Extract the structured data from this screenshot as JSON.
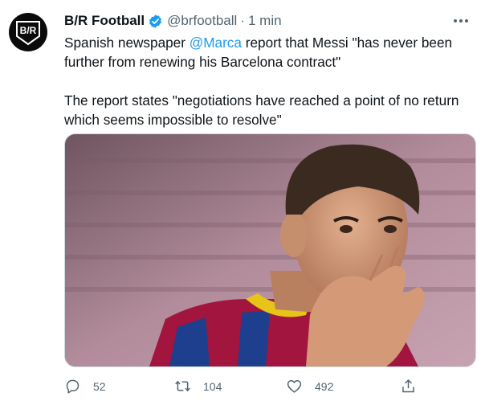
{
  "account": {
    "display_name": "B/R Football",
    "handle": "@brfootball",
    "separator": "·",
    "time": "1 min",
    "avatar_text": "B/R"
  },
  "tweet": {
    "line1_prefix": "Spanish newspaper ",
    "mention": "@Marca",
    "line1_suffix": " report that Messi \"has never been further from renewing his Barcelona contract\"",
    "paragraph2": "The report states \"negotiations have reached a point of no return which seems impossible to resolve\""
  },
  "actions": {
    "reply_count": "52",
    "retweet_count": "104",
    "like_count": "492"
  },
  "colors": {
    "accent": "#1d9bf0",
    "muted": "#536471",
    "text": "#0f1419"
  }
}
